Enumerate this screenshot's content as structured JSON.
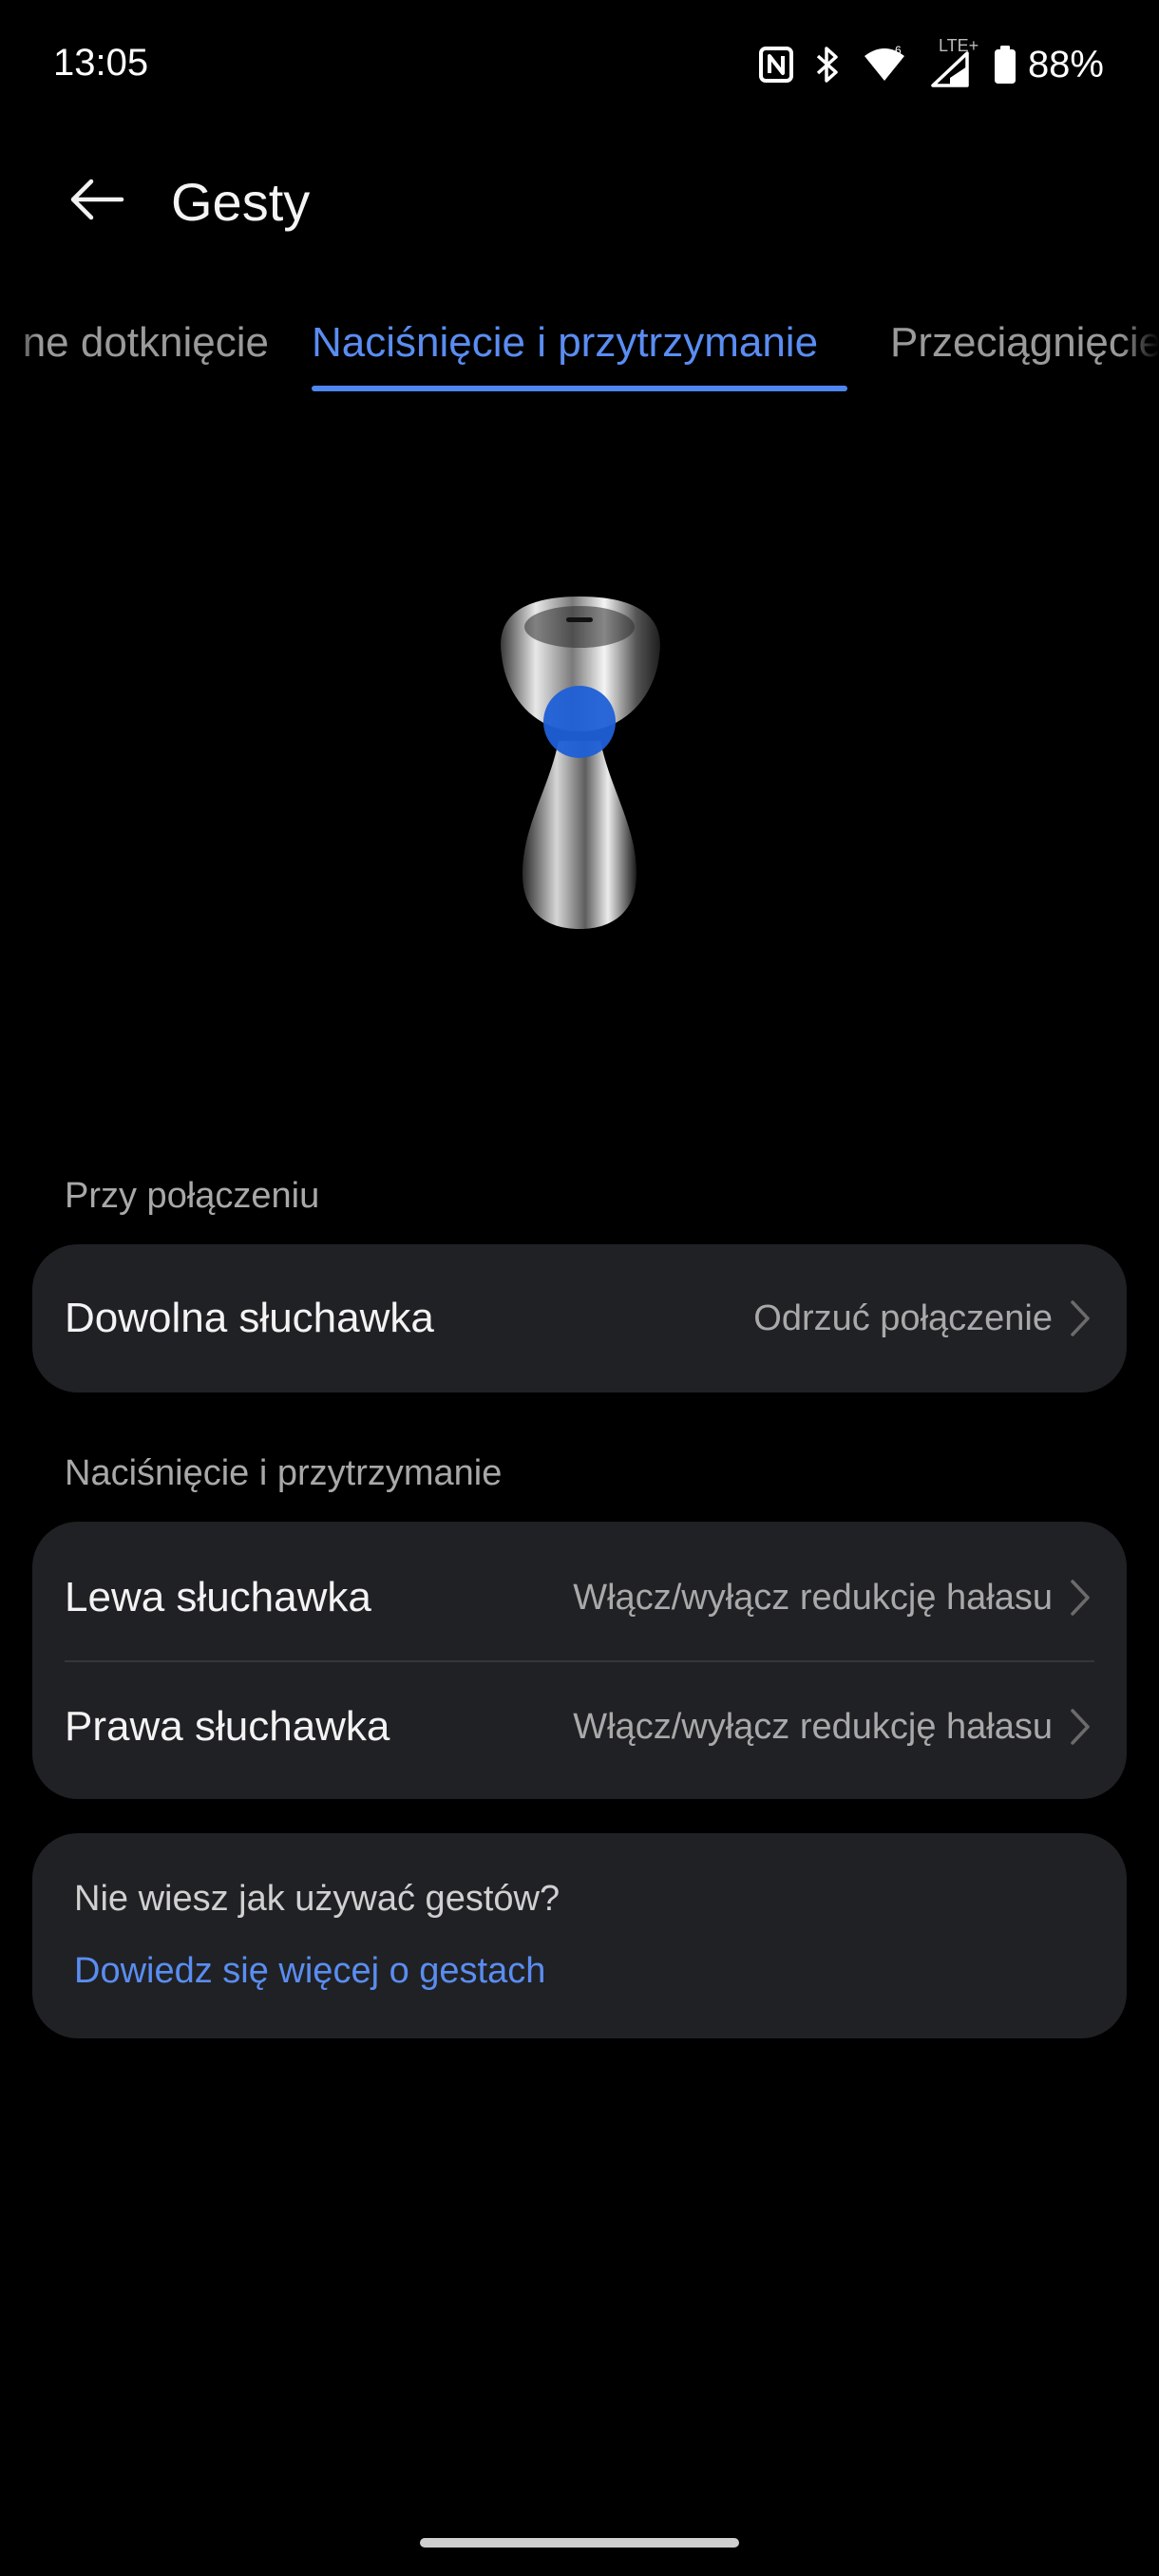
{
  "status_bar": {
    "time": "13:05",
    "battery": "88%",
    "network_type": "LTE+",
    "icons": [
      "nfc-icon",
      "bluetooth-icon",
      "wifi-icon",
      "signal-icon",
      "battery-icon"
    ]
  },
  "header": {
    "back_icon": "arrow-left-icon",
    "title": "Gesty"
  },
  "tabs": {
    "previous": "ne dotknięcie",
    "active": "Naciśnięcie i przytrzymanie",
    "next": "Przeciągnięcie"
  },
  "illustration": {
    "name": "earbud-illustration",
    "highlight_color": "#1f5fd6"
  },
  "section_call": {
    "header": "Przy połączeniu",
    "rows": [
      {
        "label": "Dowolna słuchawka",
        "value": "Odrzuć połączenie"
      }
    ]
  },
  "section_hold": {
    "header": "Naciśnięcie i przytrzymanie",
    "rows": [
      {
        "label": "Lewa słuchawka",
        "value": "Włącz/wyłącz redukcję hałasu"
      },
      {
        "label": "Prawa słuchawka",
        "value": "Włącz/wyłącz redukcję hałasu"
      }
    ]
  },
  "help": {
    "question": "Nie wiesz jak używać gestów?",
    "link": "Dowiedz się więcej o gestach"
  },
  "colors": {
    "accent": "#5a8df2",
    "card_background": "#202124",
    "background": "#000000"
  }
}
